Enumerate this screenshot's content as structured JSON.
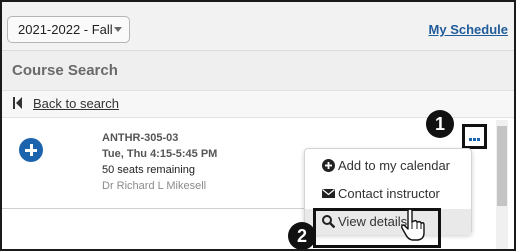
{
  "header": {
    "term": "2021-2022 - Fall",
    "my_schedule": "My Schedule"
  },
  "section": {
    "title": "Course Search",
    "back_link": "Back to search"
  },
  "course": {
    "code": "ANTHR-305-03",
    "time": "Tue, Thu 4:15-5:45 PM",
    "seats": "50 seats remaining",
    "instructor": "Dr Richard L Mikesell"
  },
  "more_menu": {
    "items": [
      {
        "label": "Add to my calendar",
        "icon": "plus-circle-icon"
      },
      {
        "label": "Contact instructor",
        "icon": "envelope-icon"
      },
      {
        "label": "View details",
        "icon": "magnifier-icon"
      }
    ],
    "highlighted_index": 2
  },
  "callouts": [
    "1",
    "2"
  ],
  "colors": {
    "accent": "#1b63ad",
    "link": "#1f5c99",
    "callout": "#111111"
  }
}
